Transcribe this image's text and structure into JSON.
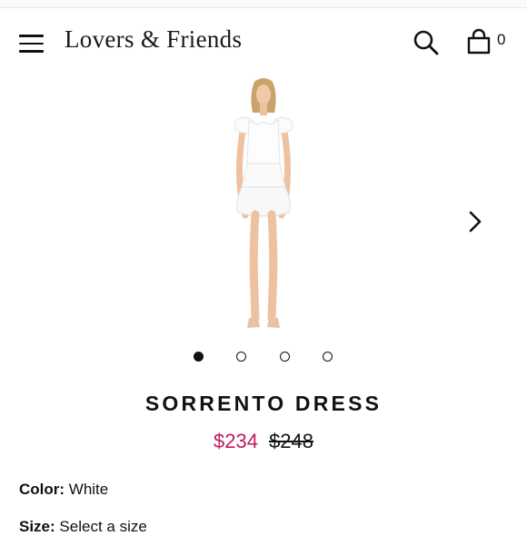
{
  "header": {
    "brand": "Lovers & Friends",
    "cart_count": "0",
    "icons": [
      "menu-icon",
      "search-icon",
      "shopping-bag-icon"
    ]
  },
  "gallery": {
    "image_count": 4,
    "active_index": 0,
    "next_icon": "chevron-right-icon"
  },
  "product": {
    "title": "SORRENTO DRESS",
    "sale_price": "$234",
    "original_price": "$248",
    "sale_color": "#c2185b",
    "color_label": "Color:",
    "color_value": "White",
    "size_label": "Size:",
    "size_value": "Select a size"
  }
}
